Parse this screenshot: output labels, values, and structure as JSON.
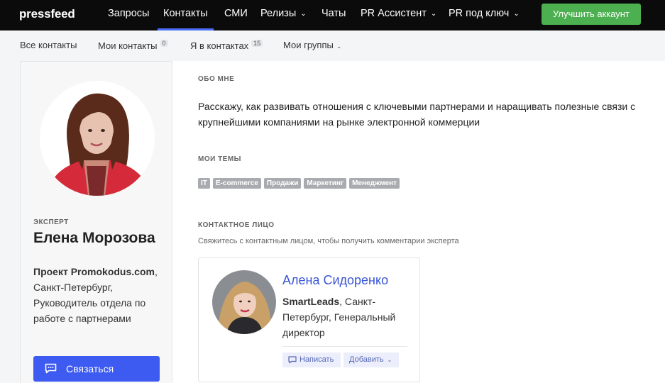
{
  "app": {
    "logo": "pressfeed"
  },
  "nav": {
    "items": [
      {
        "label": "Запросы",
        "has_dropdown": false,
        "active": false
      },
      {
        "label": "Контакты",
        "has_dropdown": false,
        "active": true
      },
      {
        "label": "СМИ",
        "has_dropdown": false,
        "active": false
      },
      {
        "label": "Релизы",
        "has_dropdown": true,
        "active": false
      },
      {
        "label": "Чаты",
        "has_dropdown": false,
        "active": false
      },
      {
        "label": "PR Ассистент",
        "has_dropdown": true,
        "active": false
      },
      {
        "label": "PR под ключ",
        "has_dropdown": true,
        "active": false
      }
    ],
    "upgrade_label": "Улучшить аккаунт",
    "chevron": "⌄"
  },
  "subnav": {
    "all": "Все контакты",
    "mine": "Мои контакты",
    "mine_count": "0",
    "in_contacts": "Я в контактах",
    "in_contacts_count": "15",
    "groups": "Мои группы"
  },
  "profile": {
    "role": "ЭКСПЕРТ",
    "name": "Елена Морозова",
    "company": "Проект Promokodus.com",
    "details": ", Санкт-Петербург, Руководитель отдела по работе с партнерами",
    "contact_button": "Связаться"
  },
  "about": {
    "title": "ОБО МНЕ",
    "text": "Расскажу, как развивать отношения с ключевыми партнерами и наращивать полезные связи с крупнейшими компаниями на рынке электронной коммерции"
  },
  "topics": {
    "title": "МОИ ТЕМЫ",
    "tags": [
      "IT",
      "E-commerce",
      "Продажи",
      "Маркетинг",
      "Менеджмент"
    ]
  },
  "contact_person": {
    "title": "КОНТАКТНОЕ ЛИЦО",
    "subtitle": "Свяжитесь с контактным лицом, чтобы получить комментарии эксперта",
    "name": "Алена Сидоренко",
    "company": "SmartLeads",
    "details": ", Санкт-Петербург, Генеральный директор",
    "write_button": "Написать",
    "add_button": "Добавить"
  },
  "colors": {
    "accent": "#3d5af1",
    "upgrade": "#4caf50",
    "topbar": "#0b0b0c"
  }
}
